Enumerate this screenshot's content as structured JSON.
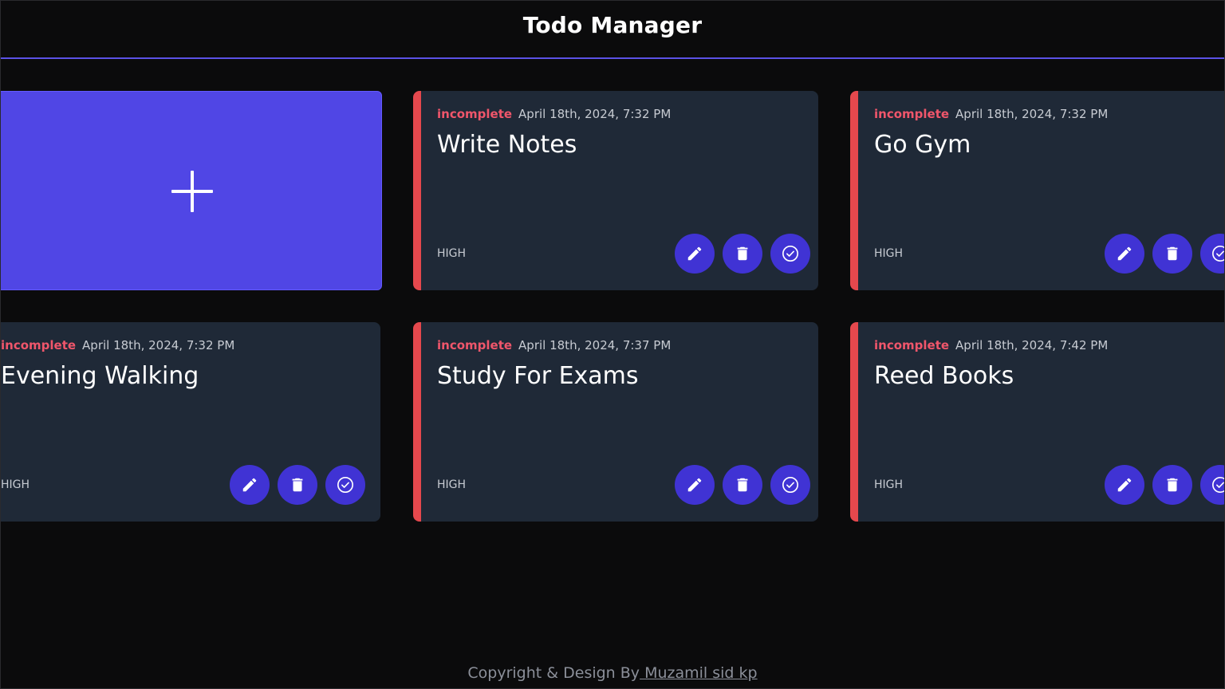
{
  "header": {
    "title": "Todo Manager"
  },
  "add_card": {
    "icon": "plus-icon"
  },
  "todos": [
    {
      "status": "incomplete",
      "date": "April 18th, 2024, 7:32 PM",
      "title": "Write Notes",
      "priority": "HIGH"
    },
    {
      "status": "incomplete",
      "date": "April 18th, 2024, 7:32 PM",
      "title": "Go Gym",
      "priority": "HIGH"
    },
    {
      "status": "incomplete",
      "date": "April 18th, 2024, 7:32 PM",
      "title": "Evening Walking",
      "priority": "HIGH"
    },
    {
      "status": "incomplete",
      "date": "April 18th, 2024, 7:37 PM",
      "title": "Study For Exams",
      "priority": "HIGH"
    },
    {
      "status": "incomplete",
      "date": "April 18th, 2024, 7:42 PM",
      "title": "Reed Books",
      "priority": "HIGH"
    }
  ],
  "actions": {
    "edit_icon": "pencil-icon",
    "delete_icon": "trash-icon",
    "complete_icon": "check-circle-icon"
  },
  "colors": {
    "accent": "#5046e5",
    "button": "#4033d4",
    "status_incomplete": "#f0566b",
    "card_bg": "#1f2937",
    "card_border": "#e5484d"
  },
  "footer": {
    "prefix": "Copyright & Design By",
    "author": " Muzamil sid kp"
  }
}
